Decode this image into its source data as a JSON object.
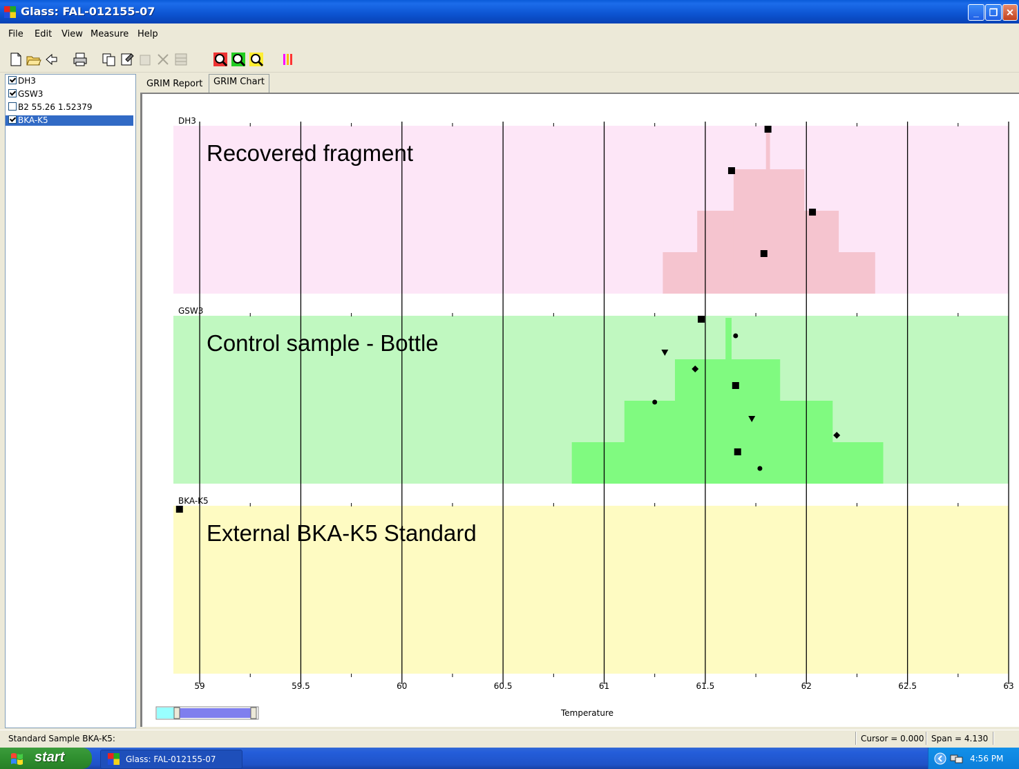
{
  "window": {
    "title": "Glass: FAL-012155-07"
  },
  "menu": [
    "File",
    "Edit",
    "View",
    "Measure",
    "Help"
  ],
  "sample_list": [
    {
      "label": "DH3",
      "checked": true,
      "selected": false
    },
    {
      "label": "GSW3",
      "checked": true,
      "selected": false
    },
    {
      "label": "B2 55.26 1.52379",
      "checked": false,
      "selected": false
    },
    {
      "label": "BKA-K5",
      "checked": true,
      "selected": true
    }
  ],
  "tabs": [
    {
      "label": "GRIM Report",
      "active": false
    },
    {
      "label": "GRIM Chart",
      "active": true
    }
  ],
  "chart_data": {
    "type": "histogram",
    "xlabel": "Temperature",
    "xlim": [
      58.87,
      63.0
    ],
    "xticks": [
      "59",
      "59.5",
      "60",
      "60.5",
      "61",
      "61.5",
      "62",
      "62.5",
      "63"
    ],
    "panels": [
      {
        "name": "DH3",
        "annotation": "Recovered fragment",
        "background": "#fde6f7",
        "bar_color": "#f5c4cf",
        "histogram": [
          {
            "from": 61.29,
            "to": 62.34,
            "level": 1
          },
          {
            "from": 61.46,
            "to": 62.16,
            "level": 2
          },
          {
            "from": 61.64,
            "to": 61.99,
            "level": 3
          },
          {
            "from": 61.8,
            "to": 61.82,
            "level": 4.4
          }
        ],
        "points": [
          {
            "x": 61.81,
            "marker": "square",
            "row": 0
          },
          {
            "x": 61.63,
            "marker": "square",
            "row": 1
          },
          {
            "x": 62.03,
            "marker": "square",
            "row": 2
          },
          {
            "x": 61.79,
            "marker": "square",
            "row": 3
          }
        ]
      },
      {
        "name": "GSW3",
        "annotation": "Control sample - Bottle",
        "background": "#c0f8c0",
        "bar_color": "#80fa80",
        "histogram": [
          {
            "from": 60.84,
            "to": 62.38,
            "level": 1
          },
          {
            "from": 61.1,
            "to": 62.13,
            "level": 2
          },
          {
            "from": 61.35,
            "to": 61.87,
            "level": 3
          },
          {
            "from": 61.6,
            "to": 61.63,
            "level": 4
          }
        ],
        "points": [
          {
            "x": 61.48,
            "marker": "square",
            "row": 0
          },
          {
            "x": 61.65,
            "marker": "dot",
            "row": 1
          },
          {
            "x": 61.3,
            "marker": "triangle",
            "row": 2
          },
          {
            "x": 61.45,
            "marker": "diamond",
            "row": 3
          },
          {
            "x": 61.65,
            "marker": "square",
            "row": 4
          },
          {
            "x": 61.25,
            "marker": "dot",
            "row": 5
          },
          {
            "x": 61.73,
            "marker": "triangle",
            "row": 6
          },
          {
            "x": 62.15,
            "marker": "diamond",
            "row": 7
          },
          {
            "x": 61.66,
            "marker": "square",
            "row": 8
          },
          {
            "x": 61.77,
            "marker": "dot",
            "row": 9
          }
        ]
      },
      {
        "name": "BKA-K5",
        "annotation": "External BKA-K5 Standard",
        "background": "#fefbc2",
        "bar_color": "#fefbc2",
        "histogram": [],
        "points": [
          {
            "x": 58.9,
            "marker": "square",
            "row": 0
          }
        ]
      }
    ]
  },
  "status": {
    "left": "Standard Sample BKA-K5:",
    "cursor": "Cursor = 0.000",
    "span": "Span = 4.130"
  },
  "taskbar": {
    "start": "start",
    "item": "Glass: FAL-012155-07",
    "time": "4:56 PM"
  }
}
